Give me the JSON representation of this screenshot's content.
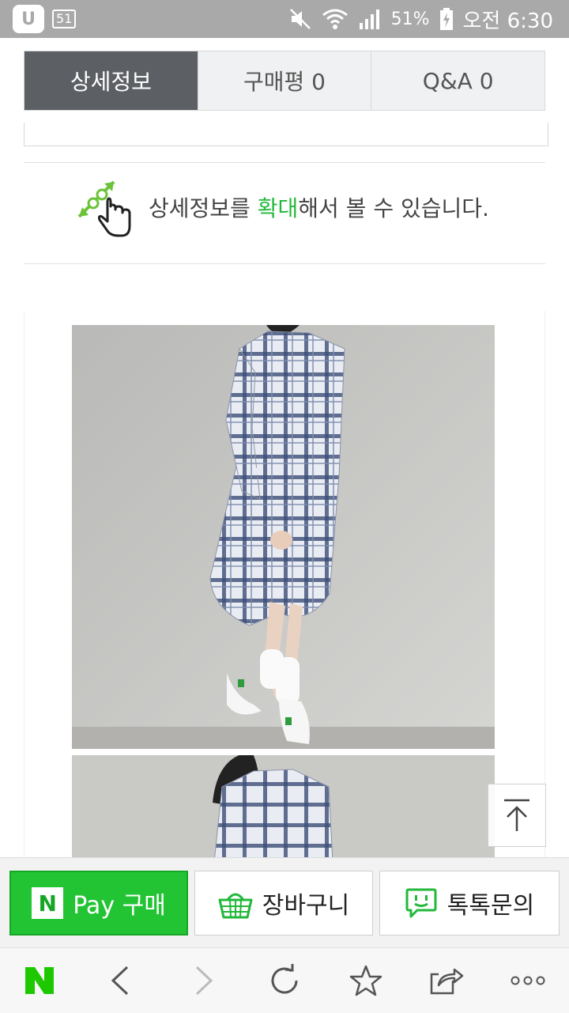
{
  "status_bar": {
    "carrier": "U",
    "network": "51",
    "battery": "51%",
    "time": "오전 6:30",
    "icons": [
      "mute-icon",
      "wifi-icon",
      "signal-icon",
      "battery-charging-icon"
    ]
  },
  "tabs": [
    {
      "label": "상세정보",
      "active": true
    },
    {
      "label": "구매평 0",
      "active": false
    },
    {
      "label": "Q&A 0",
      "active": false
    }
  ],
  "zoom_notice": {
    "prefix": "상세정보를 ",
    "highlight": "확대",
    "suffix": "해서 볼 수 있습니다.",
    "icon": "pinch-zoom-hand-icon"
  },
  "product_images": [
    {
      "name": "product-photo-plaid-shirt-dress-1"
    },
    {
      "name": "product-photo-plaid-shirt-dress-2"
    }
  ],
  "scroll_top_icon": "arrow-up-to-top-icon",
  "buy_bar": {
    "pay_n": "N",
    "pay_label": "Pay 구매",
    "cart_label": "장바구니",
    "talk_label": "톡톡문의"
  },
  "browser_nav": {
    "logo": "N",
    "icons": [
      "naver-logo-icon",
      "back-icon",
      "forward-icon",
      "refresh-icon",
      "bookmark-star-icon",
      "share-icon",
      "more-icon"
    ]
  },
  "colors": {
    "accent_green": "#22c433",
    "tab_active": "#5c5f64",
    "status_bar": "#a9a9a9"
  }
}
